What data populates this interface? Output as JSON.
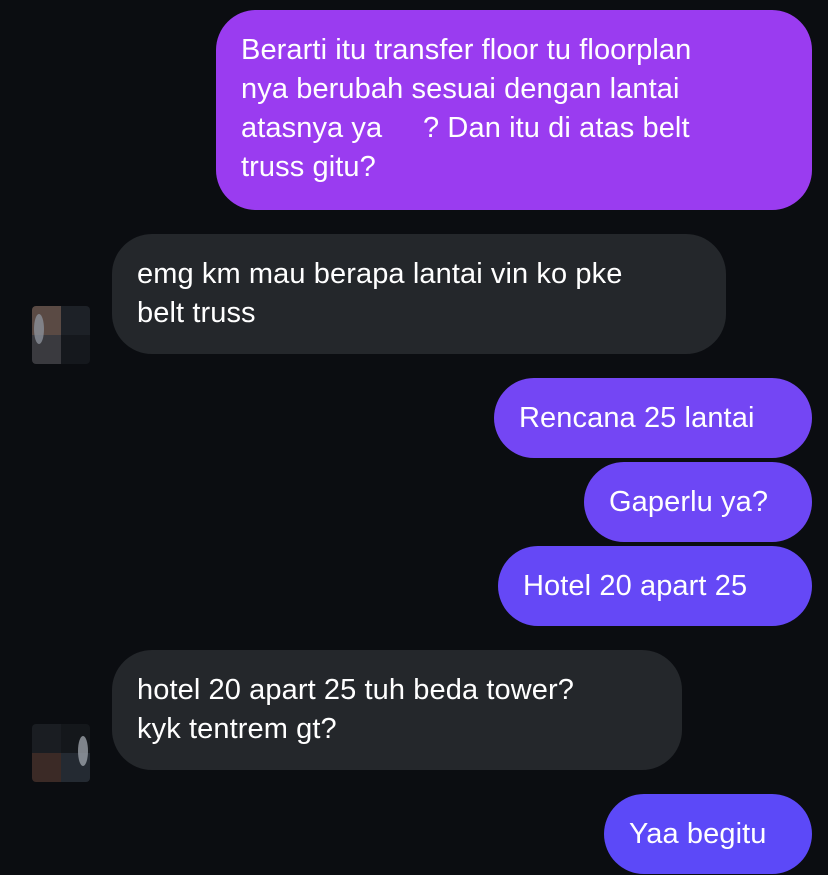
{
  "messages": [
    {
      "id": "m1",
      "direction": "outgoing",
      "lines": [
        "Berarti itu transfer floor tu floorplan",
        "nya berubah sesuai dengan lantai",
        "atasnya ya     ? Dan itu di atas belt",
        "truss gitu?"
      ]
    },
    {
      "id": "m2",
      "direction": "incoming",
      "lines": [
        "emg km mau berapa lantai vin ko pke",
        "belt truss"
      ]
    },
    {
      "id": "m3",
      "direction": "outgoing",
      "lines": [
        "Rencana 25 lantai"
      ]
    },
    {
      "id": "m4",
      "direction": "outgoing",
      "lines": [
        "Gaperlu ya?"
      ]
    },
    {
      "id": "m5",
      "direction": "outgoing",
      "lines": [
        "Hotel 20 apart 25"
      ]
    },
    {
      "id": "m6",
      "direction": "incoming",
      "lines": [
        "hotel 20 apart 25 tuh beda tower?",
        "kyk tentrem gt?"
      ]
    },
    {
      "id": "m7",
      "direction": "outgoing",
      "lines": [
        "Yaa begitu"
      ]
    }
  ],
  "avatars": [
    {
      "id": "avatar-1",
      "description_icon": "blurred-contact-avatar-icon"
    },
    {
      "id": "avatar-2",
      "description_icon": "blurred-contact-avatar-icon"
    }
  ],
  "colors": {
    "background": "#0b0d11",
    "incoming_bubble": "#24272b",
    "outgoing_gradient_top": "#9b3bf0",
    "outgoing_gradient_bottom": "#5b49f8",
    "text": "#ffffff"
  }
}
